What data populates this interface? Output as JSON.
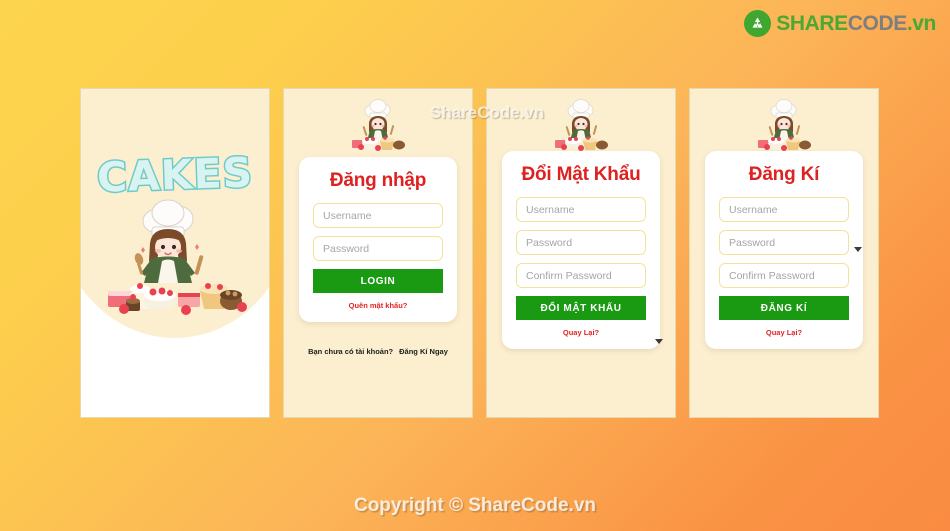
{
  "brand": {
    "icon": "recycle-circle-icon",
    "share": "SHARE",
    "code": "CODE",
    "vn": ".vn"
  },
  "watermark": {
    "center": "ShareCode.vn",
    "footer": "Copyright © ShareCode.vn"
  },
  "screens": [
    {
      "name": "splash",
      "app_title": "CAKES",
      "illustration": "chef-girl-with-cakes-illustration"
    },
    {
      "name": "login",
      "logo": "chef-girl-logo",
      "title": "Đăng nhập",
      "fields": [
        {
          "name": "username",
          "placeholder": "Username",
          "value": "",
          "type": "text"
        },
        {
          "name": "password",
          "placeholder": "Password",
          "value": "",
          "type": "password"
        }
      ],
      "submit_label": "LOGIN",
      "sub_link": "Quên mật khẩu?",
      "footer_text": "Bạn chưa có tài khoản?",
      "footer_link": "Đăng Kí Ngay"
    },
    {
      "name": "change-password",
      "logo": "chef-girl-logo",
      "title": "Đổi Mật Khẩu",
      "fields": [
        {
          "name": "username",
          "placeholder": "Username",
          "value": "",
          "type": "text"
        },
        {
          "name": "password",
          "placeholder": "Password",
          "value": "",
          "type": "password"
        },
        {
          "name": "confirm-password",
          "placeholder": "Confirm Password",
          "value": "",
          "type": "password"
        }
      ],
      "submit_label": "ĐỔI MẬT KHẨU",
      "sub_link": "Quay Lại?"
    },
    {
      "name": "register",
      "logo": "chef-girl-logo",
      "title": "Đăng Kí",
      "fields": [
        {
          "name": "username",
          "placeholder": "Username",
          "value": "",
          "type": "text"
        },
        {
          "name": "password",
          "placeholder": "Password",
          "value": "",
          "type": "password"
        },
        {
          "name": "confirm-password",
          "placeholder": "Confirm Password",
          "value": "",
          "type": "password"
        }
      ],
      "submit_label": "ĐĂNG KÍ",
      "sub_link": "Quay Lại?"
    }
  ],
  "colors": {
    "bg_gradient_start": "#FDD44E",
    "bg_gradient_end": "#F98C42",
    "panel_cream": "#FCEFCF",
    "title_red": "#DE2222",
    "button_green": "#199A12",
    "brand_green": "#4BA832",
    "brand_gray": "#7E7E7E",
    "field_border_yellow": "#F5E29A",
    "cakes_teal": "#6ECBCB"
  }
}
